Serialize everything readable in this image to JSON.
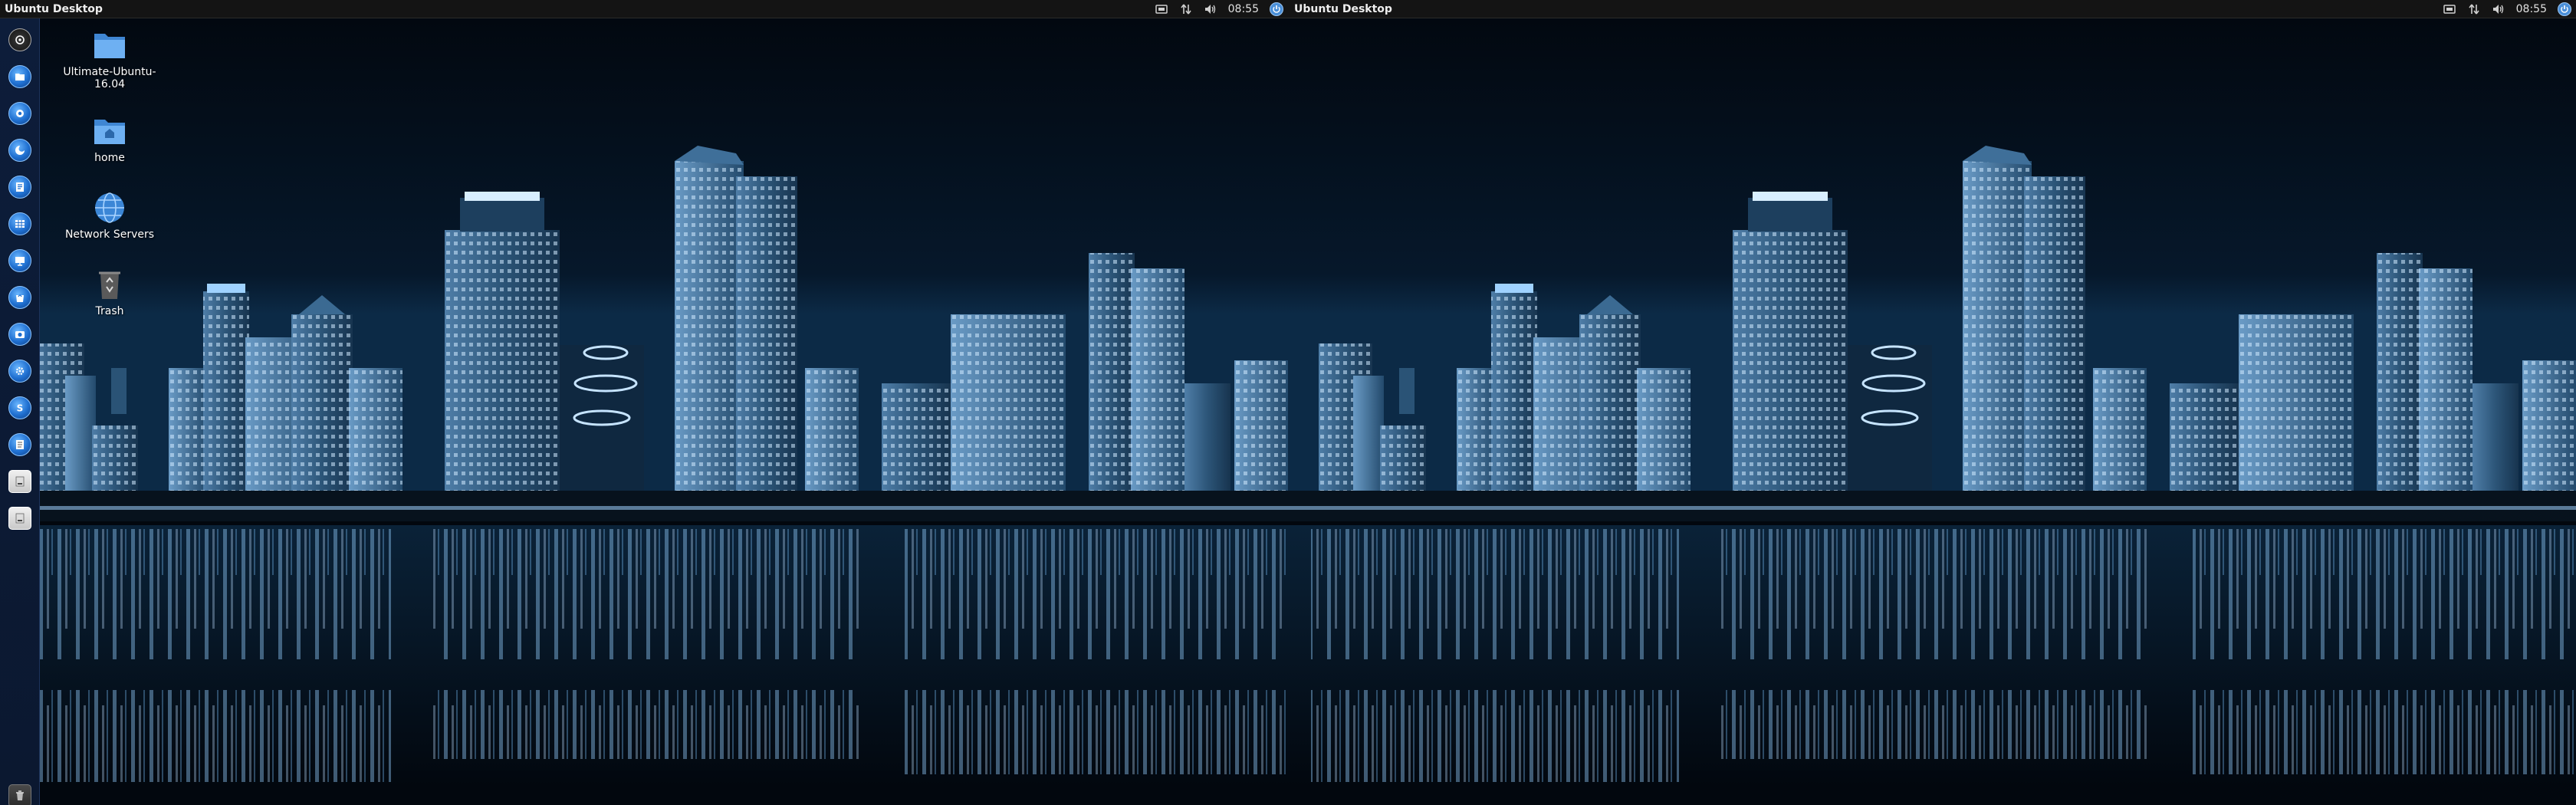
{
  "monitors": [
    {
      "panel_title": "Ubuntu Desktop",
      "clock": "08:55"
    },
    {
      "panel_title": "Ubuntu Desktop",
      "clock": "08:55"
    }
  ],
  "indicators": [
    "keyboard-icon",
    "network-icon",
    "volume-icon",
    "session-icon"
  ],
  "launcher": {
    "items": [
      {
        "name": "dash-home-icon"
      },
      {
        "name": "files-icon"
      },
      {
        "name": "web-browser-icon"
      },
      {
        "name": "firefox-icon"
      },
      {
        "name": "writer-icon"
      },
      {
        "name": "calc-icon"
      },
      {
        "name": "impress-icon"
      },
      {
        "name": "software-center-icon"
      },
      {
        "name": "camera-icon"
      },
      {
        "name": "settings-icon"
      },
      {
        "name": "skype-icon"
      },
      {
        "name": "text-editor-icon"
      },
      {
        "name": "drive-icon"
      },
      {
        "name": "removable-drive-icon"
      }
    ],
    "trash": {
      "name": "trash-icon"
    }
  },
  "desktop": {
    "icons": [
      {
        "name": "folder-icon",
        "label": "Ultimate-Ubuntu-16.04"
      },
      {
        "name": "home-folder-icon",
        "label": "home"
      },
      {
        "name": "network-servers-icon",
        "label": "Network Servers"
      },
      {
        "name": "trash-icon",
        "label": "Trash"
      }
    ]
  },
  "colors": {
    "panel": "#141414",
    "launcher": "#0d1d3a",
    "accent": "#4a8fd8",
    "sky": "#02070e",
    "city_light": "#9fd2ff"
  }
}
